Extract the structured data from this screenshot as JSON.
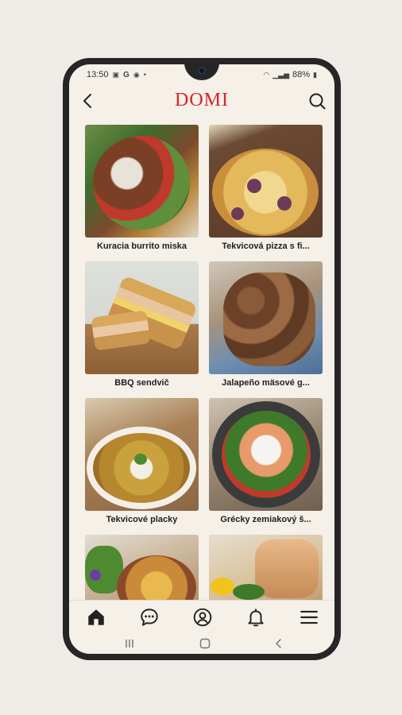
{
  "status_bar": {
    "time": "13:50",
    "indicators": "G",
    "battery": "88%"
  },
  "header": {
    "logo": "DOMI",
    "back_icon": "chevron-left-icon",
    "search_icon": "search-icon"
  },
  "recipes": [
    {
      "title": "Kuracia burrito miska"
    },
    {
      "title": "Tekvicová pizza s fi..."
    },
    {
      "title": "BBQ sendvič"
    },
    {
      "title": "Jalapeño mäsové g..."
    },
    {
      "title": "Tekvicové placky"
    },
    {
      "title": "Grécky zemiakový š..."
    },
    {
      "title": ""
    },
    {
      "title": ""
    }
  ],
  "bottom_nav": [
    {
      "name": "home-icon",
      "active": true
    },
    {
      "name": "chat-icon",
      "active": false
    },
    {
      "name": "profile-icon",
      "active": false
    },
    {
      "name": "bell-icon",
      "active": false
    },
    {
      "name": "menu-icon",
      "active": false
    }
  ],
  "colors": {
    "accent": "#d6232a",
    "background": "#f5f0e8",
    "text": "#1f1f1f"
  }
}
